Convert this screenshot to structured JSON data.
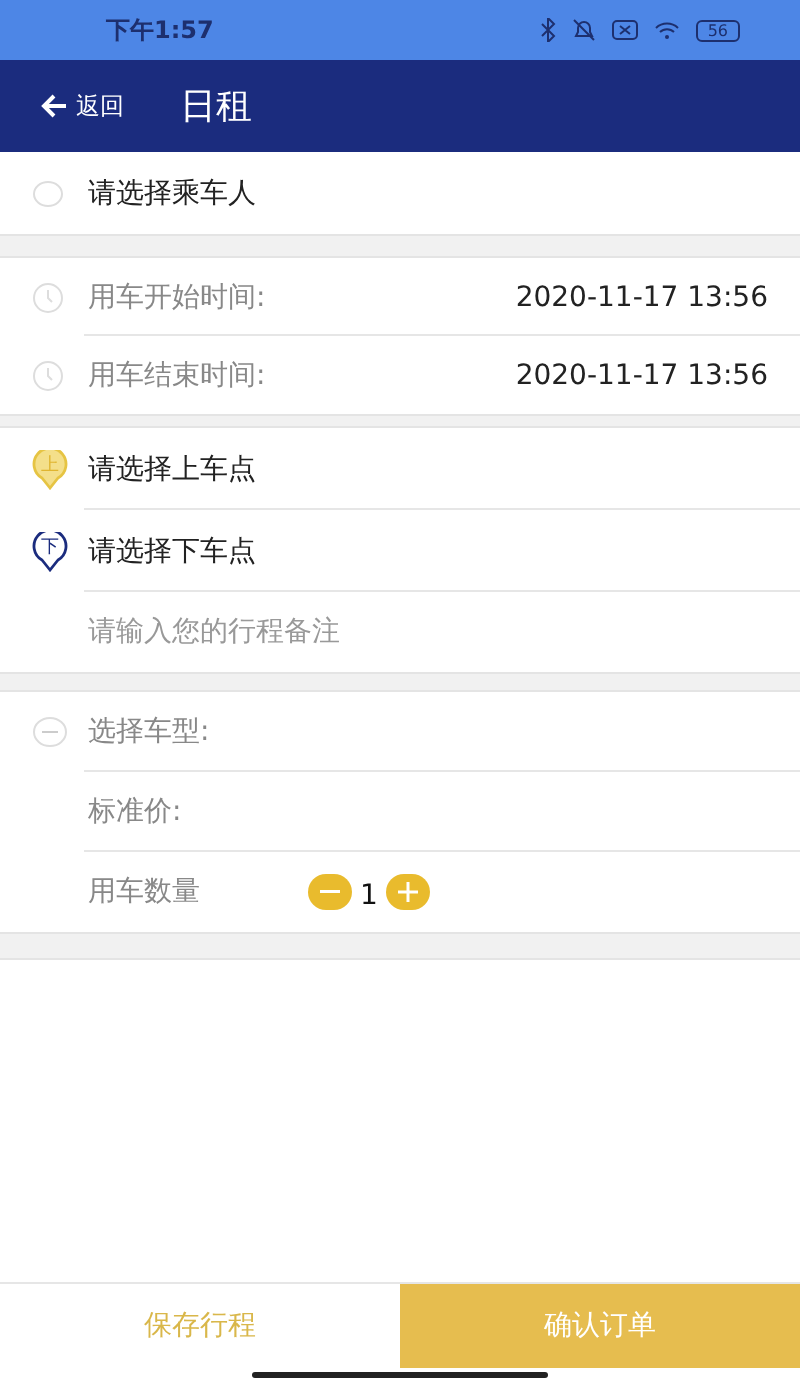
{
  "status_bar": {
    "time": "下午1:57",
    "battery": "56"
  },
  "header": {
    "back": "返回",
    "title": "日租"
  },
  "sections": [
    {
      "rows": [
        {
          "kind": "passenger",
          "label": "请选择乘车人"
        }
      ]
    },
    {
      "rows": [
        {
          "kind": "time",
          "label": "用车开始时间:",
          "value": "2020-11-17 13:56"
        },
        {
          "kind": "time",
          "label": "用车结束时间:",
          "value": "2020-11-17 13:56"
        }
      ]
    },
    {
      "rows": [
        {
          "kind": "pickup",
          "badge": "上",
          "label": "请选择上车点"
        },
        {
          "kind": "dropoff",
          "badge": "下",
          "label": "请选择下车点"
        },
        {
          "kind": "note",
          "placeholder": "请输入您的行程备注"
        }
      ]
    },
    {
      "rows": [
        {
          "kind": "car_type",
          "label": "选择车型:"
        },
        {
          "kind": "price",
          "label": "标准价:"
        },
        {
          "kind": "quantity",
          "label": "用车数量",
          "value": "1"
        }
      ]
    }
  ],
  "footer": {
    "save": "保存行程",
    "confirm": "确认订单"
  }
}
